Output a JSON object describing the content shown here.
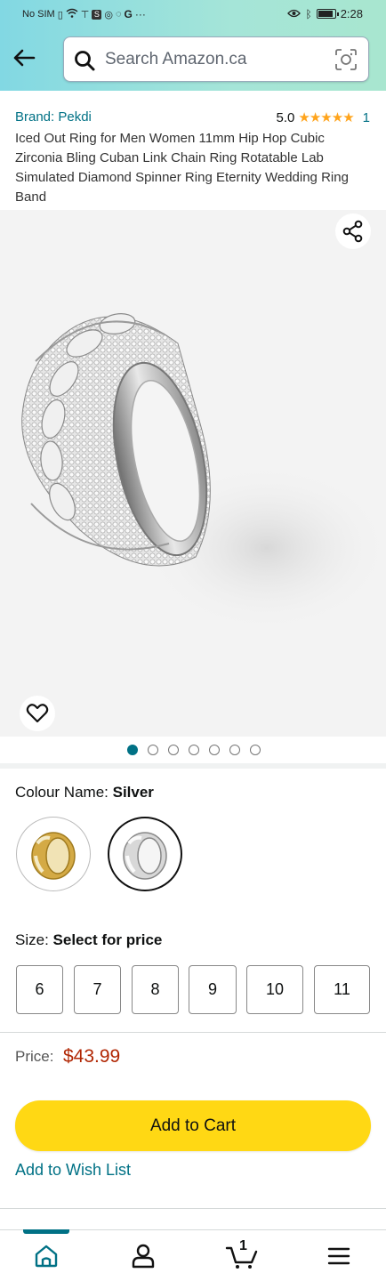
{
  "status_bar": {
    "carrier": "No SIM",
    "icons": [
      "sim-icon",
      "wifi-icon",
      "signal-icon",
      "s-app-icon",
      "circle-app-icon",
      "whatsapp-icon",
      "google-icon",
      "more-icon"
    ],
    "right_icons": [
      "eye-icon",
      "bluetooth-icon",
      "battery-icon"
    ],
    "time": "2:28"
  },
  "header": {
    "search_placeholder": "Search Amazon.ca",
    "gradient_colors": [
      "#82d8e3",
      "#a8e6cf"
    ]
  },
  "product": {
    "brand": "Brand: Pekdi",
    "rating_value": "5.0",
    "stars": "★★★★★",
    "rating_count": "1",
    "title": "Iced Out Ring for Men Women 11mm Hip Hop Cubic Zirconia Bling Cuban Link Chain Ring Rotatable Lab Simulated Diamond Spinner Ring Eternity Wedding Ring Band"
  },
  "gallery": {
    "image_count": 7,
    "active_index": 0
  },
  "colour": {
    "label": "Colour Name: ",
    "selected": "Silver",
    "options": [
      "Gold",
      "Silver"
    ]
  },
  "size": {
    "label": "Size: ",
    "prompt": "Select for price",
    "options": [
      "6",
      "7",
      "8",
      "9",
      "10",
      "11"
    ]
  },
  "price": {
    "label": "Price:",
    "value": "$43.99"
  },
  "actions": {
    "add_to_cart": "Add to Cart",
    "add_to_wish_list": "Add to Wish List"
  },
  "bottom_nav": {
    "items": [
      "home-icon",
      "account-icon",
      "cart-icon",
      "menu-icon"
    ],
    "cart_count": "1",
    "active": "home-icon"
  },
  "colors": {
    "link": "#007185",
    "price": "#b12704",
    "cart_button": "#ffd814",
    "star": "#ffa41c"
  }
}
